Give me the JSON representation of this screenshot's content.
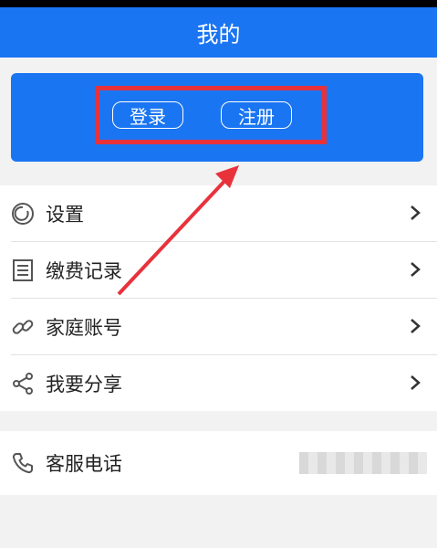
{
  "header": {
    "title": "我的"
  },
  "login_card": {
    "login_label": "登录",
    "register_label": "注册"
  },
  "menu": {
    "items": [
      {
        "label": "设置",
        "icon": "settings-icon"
      },
      {
        "label": "缴费记录",
        "icon": "record-list-icon"
      },
      {
        "label": "家庭账号",
        "icon": "link-icon"
      },
      {
        "label": "我要分享",
        "icon": "share-icon"
      }
    ]
  },
  "service": {
    "label": "客服电话",
    "icon": "phone-icon"
  },
  "colors": {
    "primary": "#1a75f2",
    "annotation": "#e8323b"
  }
}
